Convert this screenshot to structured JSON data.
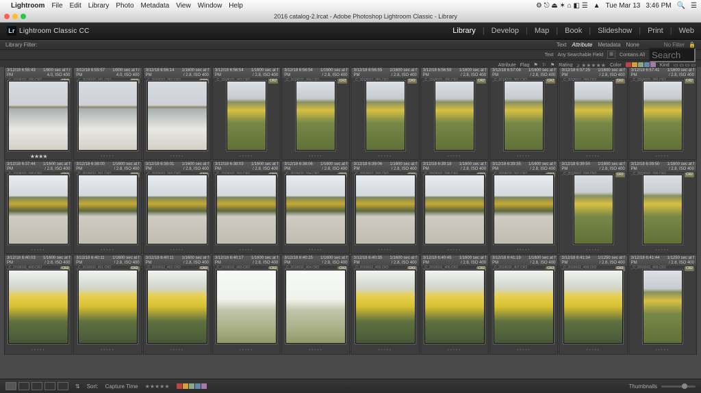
{
  "macos": {
    "app_name": "Lightroom",
    "menus": [
      "File",
      "Edit",
      "Library",
      "Photo",
      "Metadata",
      "View",
      "Window",
      "Help"
    ],
    "right_status": [
      "Tue Mar 13",
      "3:46 PM"
    ]
  },
  "window": {
    "title": "2016 catalog-2.lrcat - Adobe Photoshop Lightroom Classic - Library"
  },
  "brand": "Lightroom Classic CC",
  "modules": [
    "Library",
    "Develop",
    "Map",
    "Book",
    "Slideshow",
    "Print",
    "Web"
  ],
  "active_module": "Library",
  "filterbar": {
    "label": "Library Filter:",
    "tabs": [
      "Text",
      "Attribute",
      "Metadata",
      "None"
    ],
    "active_tab": "Attribute",
    "right_field_label": "Text",
    "any_field": "Any Searchable Field",
    "contains": "Contains All",
    "search_placeholder": "Search",
    "filter_preset": "No Filter"
  },
  "attrbar": {
    "label": "Attribute",
    "flag": "Flag",
    "rating": "Rating",
    "color": "Color",
    "kind": "Kind",
    "colors": [
      "#b44",
      "#d8a030",
      "#8a8",
      "#68a",
      "#a7a"
    ]
  },
  "cell_defaults": {
    "settings": "1/1600 sec at f / 2.8, ISO 400",
    "settings_alt": "1/800 sec at f / 4.0, ISO 400",
    "settings_alt2": "1/1250 sec at f / 2.8, ISO 400",
    "id_prefix": "_C_2018032",
    "badge": "CR2"
  },
  "rows": [
    {
      "cells": [
        {
          "time": "3/12/18 6:55:43 PM",
          "s": "settings_alt",
          "img": "img-sidewalk",
          "orient": "wide",
          "rated": true
        },
        {
          "time": "3/12/18 6:55:57 PM",
          "s": "settings_alt",
          "img": "img-sidewalk",
          "orient": "wide"
        },
        {
          "time": "3/12/18 6:56:14 PM",
          "s": "settings",
          "img": "img-sidewalk",
          "orient": "wide"
        },
        {
          "time": "3/12/18 6:56:54 PM",
          "s": "settings",
          "img": "img-daff-tall",
          "orient": "tall"
        },
        {
          "time": "3/12/18 6:56:54 PM",
          "s": "settings",
          "img": "img-daff-tall",
          "orient": "tall"
        },
        {
          "time": "3/12/18 6:56:55 PM",
          "s": "settings",
          "img": "img-daff-tall",
          "orient": "tall"
        },
        {
          "time": "3/12/18 6:56:59 PM",
          "s": "settings",
          "img": "img-daff-tall",
          "orient": "tall"
        },
        {
          "time": "3/12/18 6:57:08 PM",
          "s": "settings",
          "img": "img-daff-tall",
          "orient": "tall"
        },
        {
          "time": "3/12/18 6:57:25 PM",
          "s": "settings",
          "img": "img-daff-tall",
          "orient": "tall"
        },
        {
          "time": "3/12/18 6:57:41 PM",
          "s": "settings",
          "img": "img-daff-tall",
          "orient": "tall"
        }
      ]
    },
    {
      "cells": [
        {
          "time": "3/12/18 6:37:44 PM",
          "s": "settings",
          "img": "img-daff-walk",
          "orient": "wide"
        },
        {
          "time": "3/12/18 6:38:00 PM",
          "s": "settings",
          "img": "img-daff-walk",
          "orient": "wide"
        },
        {
          "time": "3/12/18 6:38:01 PM",
          "s": "settings",
          "img": "img-daff-walk",
          "orient": "wide"
        },
        {
          "time": "3/12/18 6:38:03 PM",
          "s": "settings",
          "img": "img-daff-walk",
          "orient": "wide"
        },
        {
          "time": "3/12/18 6:38:06 PM",
          "s": "settings",
          "img": "img-daff-walk",
          "orient": "wide"
        },
        {
          "time": "3/12/18 6:39:06 PM",
          "s": "settings",
          "img": "img-daff-walk",
          "orient": "wide"
        },
        {
          "time": "3/12/18 6:39:18 PM",
          "s": "settings",
          "img": "img-daff-walk",
          "orient": "wide"
        },
        {
          "time": "3/12/18 6:39:35 PM",
          "s": "settings",
          "img": "img-daff-walk",
          "orient": "wide"
        },
        {
          "time": "3/12/18 6:39:50 PM",
          "s": "settings",
          "img": "img-daff-tall",
          "orient": "tall"
        },
        {
          "time": "3/12/18 6:39:50 PM",
          "s": "settings",
          "img": "img-daff-tall",
          "orient": "tall"
        }
      ]
    },
    {
      "cells": [
        {
          "time": "3/12/18 6:40:03 PM",
          "s": "settings",
          "img": "img-daff-close",
          "orient": "wide"
        },
        {
          "time": "3/12/18 6:40:11 PM",
          "s": "settings",
          "img": "img-daff-close",
          "orient": "wide"
        },
        {
          "time": "3/12/18 6:40:11 PM",
          "s": "settings",
          "img": "img-daff-close",
          "orient": "wide"
        },
        {
          "time": "3/12/18 6:40:17 PM",
          "s": "settings",
          "img": "img-bright",
          "orient": "wide"
        },
        {
          "time": "3/12/18 6:40:25 PM",
          "s": "settings",
          "img": "img-bright",
          "orient": "wide"
        },
        {
          "time": "3/12/18 6:40:35 PM",
          "s": "settings",
          "img": "img-daff-close",
          "orient": "wide"
        },
        {
          "time": "3/12/18 6:40:45 PM",
          "s": "settings",
          "img": "img-daff-close",
          "orient": "wide"
        },
        {
          "time": "3/12/18 6:41:19 PM",
          "s": "settings",
          "img": "img-daff-close",
          "orient": "wide"
        },
        {
          "time": "3/12/18 6:41:34 PM",
          "s": "settings_alt2",
          "img": "img-daff-close",
          "orient": "wide"
        },
        {
          "time": "3/12/18 6:41:44 PM",
          "s": "settings_alt2",
          "img": "img-daff-tall",
          "orient": "tall"
        }
      ]
    }
  ],
  "toolbar": {
    "sort_label": "Sort:",
    "sort_value": "Capture Time",
    "thumbnails": "Thumbnails"
  }
}
